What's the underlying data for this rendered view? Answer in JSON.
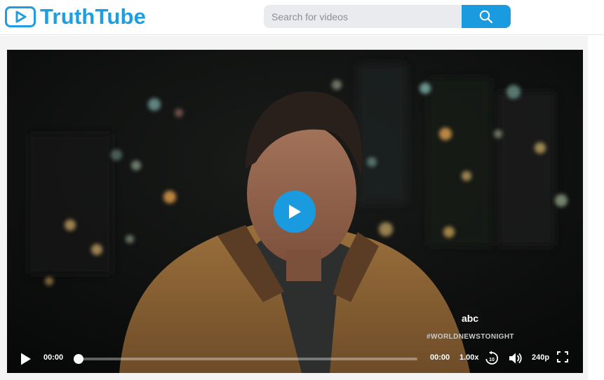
{
  "app": {
    "name": "TruthTube",
    "brand_color": "#1e9ee0"
  },
  "search": {
    "placeholder": "Search for videos",
    "value": "",
    "button_icon": "search-icon"
  },
  "player": {
    "current_time": "00:00",
    "duration": "00:00",
    "progress_fraction": 0,
    "speed": "1.00x",
    "quality": "240p",
    "skip_icon": "rewind-10-icon",
    "volume_icon": "volume-icon",
    "fullscreen_icon": "fullscreen-icon",
    "accent_color": "#1a9be0"
  },
  "video_overlay": {
    "network_logo": "abc",
    "hashtag": "#WORLDNEWSTONIGHT"
  }
}
